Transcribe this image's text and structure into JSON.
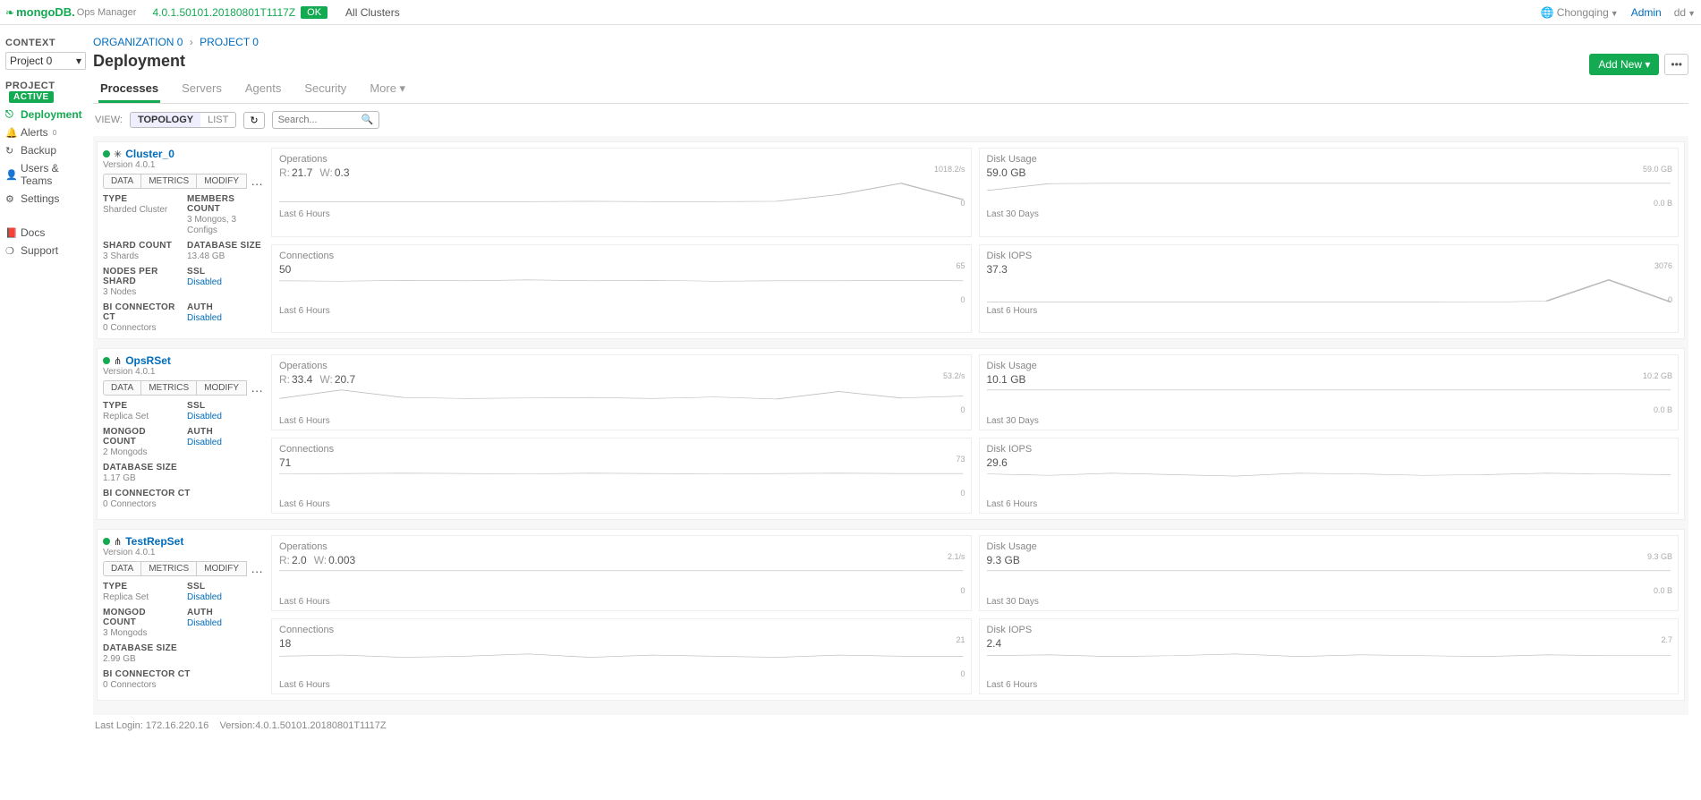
{
  "topbar": {
    "brand_main": "mongoDB.",
    "brand_suffix": "Ops Manager",
    "version": "4.0.1.50101.20180801T1117Z",
    "status": "OK",
    "all_clusters": "All Clusters",
    "region": "Chongqing",
    "admin": "Admin",
    "user": "dd"
  },
  "sidebar": {
    "context_label": "CONTEXT",
    "context_value": "Project 0",
    "project_label": "PROJECT",
    "project_status": "ACTIVE",
    "nav": {
      "deployment": "Deployment",
      "alerts": "Alerts",
      "backup": "Backup",
      "users": "Users & Teams",
      "settings": "Settings",
      "docs": "Docs",
      "support": "Support"
    }
  },
  "crumbs": {
    "org": "ORGANIZATION 0",
    "proj": "PROJECT 0"
  },
  "page": {
    "title": "Deployment",
    "add_new": "Add New"
  },
  "tabs": {
    "processes": "Processes",
    "servers": "Servers",
    "agents": "Agents",
    "security": "Security",
    "more": "More"
  },
  "toolbar": {
    "view_label": "VIEW:",
    "topology": "TOPOLOGY",
    "list": "LIST",
    "search_placeholder": "Search..."
  },
  "labels": {
    "type": "TYPE",
    "members_count": "MEMBERS COUNT",
    "shard_count": "SHARD COUNT",
    "database_size": "DATABASE SIZE",
    "nodes_per_shard": "NODES PER SHARD",
    "ssl": "SSL",
    "auth": "AUTH",
    "bi_connector": "BI CONNECTOR CT",
    "mongod_count": "MONGOD COUNT",
    "disabled": "Disabled",
    "data": "DATA",
    "metrics": "METRICS",
    "modify": "MODIFY",
    "version_prefix": "Version 4.0.1"
  },
  "chart_labels": {
    "operations": "Operations",
    "connections": "Connections",
    "disk_usage": "Disk Usage",
    "disk_iops": "Disk IOPS",
    "last6": "Last 6 Hours",
    "last30": "Last 30 Days",
    "r": "R:",
    "w": "W:"
  },
  "clusters": [
    {
      "name": "Cluster_0",
      "icon": "sharded",
      "type": "Sharded Cluster",
      "members": "3 Mongos, 3 Configs",
      "shard_count": "3 Shards",
      "db_size": "13.48 GB",
      "nodes_per_shard": "3 Nodes",
      "bi": "0 Connectors",
      "ops_r": "21.7",
      "ops_w": "0.3",
      "conn": "50",
      "disk": "59.0 GB",
      "iops": "37.3"
    },
    {
      "name": "OpsRSet",
      "icon": "replset",
      "type": "Replica Set",
      "mongod": "2 Mongods",
      "db_size": "1.17 GB",
      "bi": "0 Connectors",
      "ops_r": "33.4",
      "ops_w": "20.7",
      "conn": "71",
      "disk": "10.1 GB",
      "iops": "29.6"
    },
    {
      "name": "TestRepSet",
      "icon": "replset",
      "type": "Replica Set",
      "mongod": "3 Mongods",
      "db_size": "2.99 GB",
      "bi": "0 Connectors",
      "ops_r": "2.0",
      "ops_w": "0.003",
      "conn": "18",
      "disk": "9.3 GB",
      "iops": "2.4"
    }
  ],
  "chart_data": [
    {
      "name": "Cluster_0 Operations",
      "type": "line",
      "title": "Operations",
      "xlabel": "Last 6 Hours",
      "yhi": "1018.2/s",
      "ylo": "0",
      "values": [
        15,
        15,
        15,
        15,
        15,
        16,
        15,
        15,
        16,
        40,
        80,
        22
      ]
    },
    {
      "name": "Cluster_0 Disk Usage",
      "type": "line",
      "title": "Disk Usage",
      "xlabel": "Last 30 Days",
      "yhi": "59.0 GB",
      "ylo": "0.0 B",
      "values": [
        40,
        58,
        59,
        59,
        59,
        59,
        59,
        59,
        59,
        59,
        59,
        59
      ]
    },
    {
      "name": "Cluster_0 Connections",
      "type": "line",
      "title": "Connections",
      "xlabel": "Last 6 Hours",
      "yhi": "65",
      "ylo": "0",
      "values": [
        50,
        49,
        51,
        50,
        52,
        50,
        51,
        49,
        50,
        50,
        51,
        50
      ]
    },
    {
      "name": "Cluster_0 Disk IOPS",
      "type": "line",
      "title": "Disk IOPS",
      "xlabel": "Last 6 Hours",
      "yhi": "3076",
      "ylo": "0",
      "values": [
        30,
        32,
        31,
        33,
        30,
        34,
        31,
        30,
        29,
        180,
        2800,
        37
      ]
    },
    {
      "name": "OpsRSet Operations",
      "type": "line",
      "title": "Operations",
      "xlabel": "Last 6 Hours",
      "yhi": "53.2/s",
      "ylo": "0",
      "values": [
        28,
        45,
        30,
        28,
        29,
        30,
        28,
        31,
        27,
        42,
        29,
        33
      ]
    },
    {
      "name": "OpsRSet Disk Usage",
      "type": "line",
      "title": "Disk Usage",
      "xlabel": "Last 30 Days",
      "yhi": "10.2 GB",
      "ylo": "0.0 B",
      "values": [
        10,
        10,
        10,
        10,
        10,
        10,
        10,
        10,
        10,
        10,
        10,
        10
      ]
    },
    {
      "name": "OpsRSet Connections",
      "type": "line",
      "title": "Connections",
      "xlabel": "Last 6 Hours",
      "yhi": "73",
      "ylo": "0",
      "values": [
        70,
        71,
        72,
        71,
        70,
        72,
        71,
        70,
        71,
        72,
        71,
        71
      ]
    },
    {
      "name": "OpsRSet Disk IOPS",
      "type": "line",
      "title": "Disk IOPS",
      "xlabel": "Last 6 Hours",
      "yhi": "",
      "ylo": "",
      "values": [
        30,
        28,
        31,
        29,
        27,
        31,
        30,
        28,
        29,
        31,
        30,
        29
      ]
    },
    {
      "name": "TestRepSet Operations",
      "type": "line",
      "title": "Operations",
      "xlabel": "Last 6 Hours",
      "yhi": "2.1/s",
      "ylo": "0",
      "values": [
        2,
        2,
        2,
        2,
        2,
        2,
        2,
        2,
        2,
        2,
        2,
        2
      ]
    },
    {
      "name": "TestRepSet Disk Usage",
      "type": "line",
      "title": "Disk Usage",
      "xlabel": "Last 30 Days",
      "yhi": "9.3 GB",
      "ylo": "0.0 B",
      "values": [
        9,
        9,
        9,
        9,
        9,
        9,
        9,
        9,
        9,
        9,
        9,
        9
      ]
    },
    {
      "name": "TestRepSet Connections",
      "type": "line",
      "title": "Connections",
      "xlabel": "Last 6 Hours",
      "yhi": "21",
      "ylo": "0",
      "values": [
        18,
        19,
        17,
        18,
        20,
        17,
        19,
        18,
        17,
        19,
        18,
        18
      ]
    },
    {
      "name": "TestRepSet Disk IOPS",
      "type": "line",
      "title": "Disk IOPS",
      "xlabel": "Last 6 Hours",
      "yhi": "2.7",
      "ylo": "",
      "values": [
        2.4,
        2.5,
        2.3,
        2.4,
        2.6,
        2.3,
        2.5,
        2.4,
        2.3,
        2.5,
        2.4,
        2.4
      ]
    }
  ],
  "footer": {
    "last_login_label": "Last Login:",
    "last_login": "172.16.220.16",
    "version_label": "Version:",
    "version": "4.0.1.50101.20180801T1117Z"
  }
}
